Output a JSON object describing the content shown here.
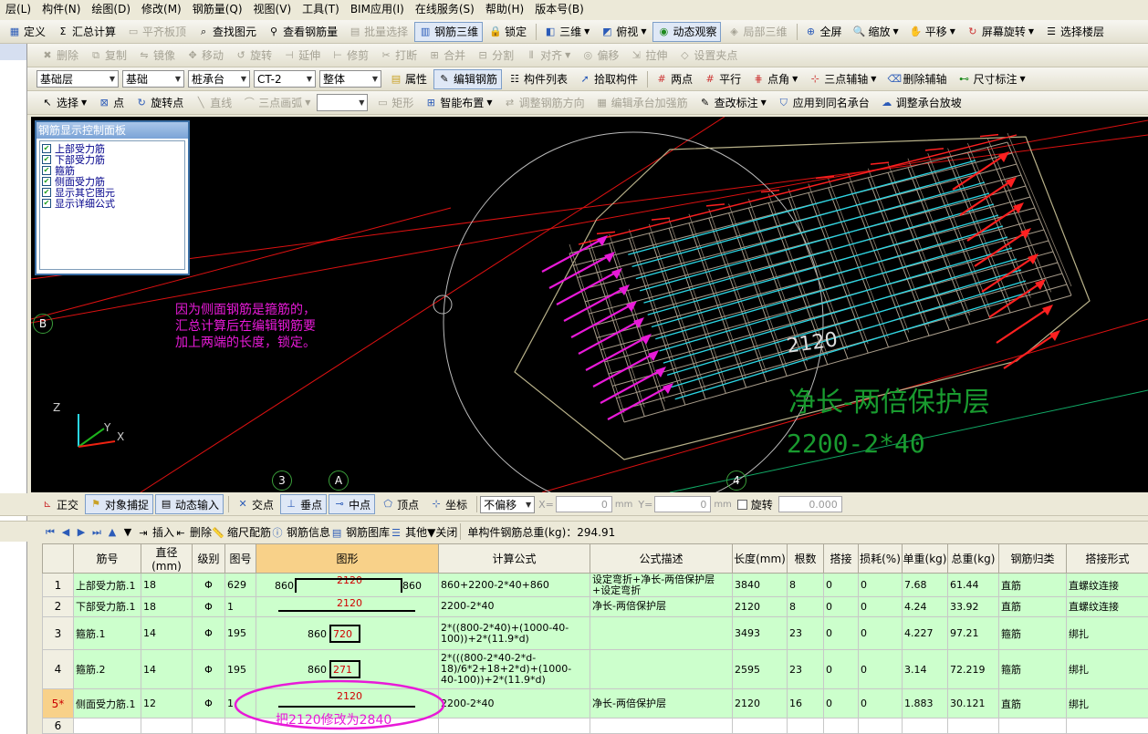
{
  "menu": [
    "层(L)",
    "构件(N)",
    "绘图(D)",
    "修改(M)",
    "钢筋量(Q)",
    "视图(V)",
    "工具(T)",
    "BIM应用(I)",
    "在线服务(S)",
    "帮助(H)",
    "版本号(B)"
  ],
  "toolbar1": {
    "define": "定义",
    "sum_calc": "汇总计算",
    "flush_board": "平齐板顶",
    "find_element": "查找图元",
    "view_rebar_qty": "查看钢筋量",
    "batch_select": "批量选择",
    "rebar_3d": "钢筋三维",
    "lock": "锁定",
    "view_3d": "三维",
    "top_view": "俯视",
    "dynamic_observe": "动态观察",
    "local_3d": "局部三维",
    "fullscreen": "全屏",
    "zoom": "缩放",
    "pan": "平移",
    "screen_rotate": "屏幕旋转",
    "select_floor": "选择楼层"
  },
  "toolbar2": {
    "delete": "删除",
    "copy": "复制",
    "mirror": "镜像",
    "move": "移动",
    "rotate": "旋转",
    "extend": "延伸",
    "trim": "修剪",
    "break": "打断",
    "merge": "合并",
    "split": "分割",
    "align": "对齐",
    "offset": "偏移",
    "stretch": "拉伸",
    "set_clamp": "设置夹点"
  },
  "toolbar3": {
    "layer": "基础层",
    "category": "基础",
    "element_type": "桩承台",
    "element_name": "CT-2",
    "scope": "整体",
    "properties": "属性",
    "edit_rebar": "编辑钢筋",
    "element_list": "构件列表",
    "pick_element": "拾取构件",
    "two_points": "两点",
    "parallel": "平行",
    "point_angle": "点角",
    "three_point_aux": "三点辅轴",
    "delete_aux": "删除辅轴",
    "dim_label": "尺寸标注"
  },
  "toolbar4": {
    "select": "选择",
    "point": "点",
    "rotate_point": "旋转点",
    "line": "直线",
    "three_point_arc": "三点画弧",
    "rect": "矩形",
    "smart_layout": "智能布置",
    "adjust_rebar_dir": "调整钢筋方向",
    "edit_cap_rebar": "编辑承台加强筋",
    "view_label": "查改标注",
    "apply_same_cap": "应用到同名承台",
    "adjust_cap_slope": "调整承台放坡"
  },
  "control_panel": {
    "title": "钢筋显示控制面板",
    "items": [
      "上部受力筋",
      "下部受力筋",
      "箍筋",
      "侧面受力筋",
      "显示其它图元",
      "显示详细公式"
    ]
  },
  "viewport": {
    "annotation": [
      "因为侧面钢筋是箍筋的，",
      "汇总计算后在编辑钢筋要",
      "加上两端的长度，锁定。"
    ],
    "dim_text": "2120",
    "green_note1": "净长-两倍保护层",
    "green_note2": "2200-2*40",
    "grid_labels": {
      "b": "B",
      "three": "3",
      "a": "A",
      "four": "4"
    },
    "axes": {
      "z": "Z",
      "y": "Y",
      "x": "X"
    }
  },
  "snapbar": {
    "ortho": "正交",
    "object_snap": "对象捕捉",
    "dynamic_input": "动态输入",
    "intersection": "交点",
    "perpendicular": "垂点",
    "midpoint": "中点",
    "vertex": "顶点",
    "coordinate": "坐标",
    "offset_mode": "不偏移",
    "x_label": "X=",
    "x_value": "0",
    "y_label": "Y=",
    "y_value": "0",
    "unit": "mm",
    "rotate": "旋转",
    "rotate_value": "0.000"
  },
  "tablebar": {
    "insert": "插入",
    "delete": "删除",
    "scale_rebar": "缩尺配筋",
    "rebar_info": "钢筋信息",
    "rebar_lib": "钢筋图库",
    "other": "其他",
    "close": "关闭",
    "total_weight": "单构件钢筋总重(kg)：294.91"
  },
  "table": {
    "headers": [
      "筋号",
      "直径(mm)",
      "级别",
      "图号",
      "图形",
      "计算公式",
      "公式描述",
      "长度(mm)",
      "根数",
      "搭接",
      "损耗(%)",
      "单重(kg)",
      "总重(kg)",
      "钢筋归类",
      "搭接形式"
    ],
    "rows": [
      {
        "n": "1",
        "name": "上部受力筋.1",
        "dia": "18",
        "grade": "Φ",
        "fig": "629",
        "s_left": "860",
        "s_mid": "2120",
        "s_right": "860",
        "formula": "860+2200-2*40+860",
        "desc": "设定弯折+净长-两倍保护层+设定弯折",
        "len": "3840",
        "qty": "8",
        "lap": "0",
        "loss": "0",
        "unit_w": "7.68",
        "total_w": "61.44",
        "cat": "直筋",
        "lap_type": "直螺纹连接"
      },
      {
        "n": "2",
        "name": "下部受力筋.1",
        "dia": "18",
        "grade": "Φ",
        "fig": "1",
        "s_mid": "2120",
        "formula": "2200-2*40",
        "desc": "净长-两倍保护层",
        "len": "2120",
        "qty": "8",
        "lap": "0",
        "loss": "0",
        "unit_w": "4.24",
        "total_w": "33.92",
        "cat": "直筋",
        "lap_type": "直螺纹连接"
      },
      {
        "n": "3",
        "name": "箍筋.1",
        "dia": "14",
        "grade": "Φ",
        "fig": "195",
        "s_left": "860",
        "s_mid": "720",
        "formula": "2*((800-2*40)+(1000-40-100))+2*(11.9*d)",
        "desc": "",
        "len": "3493",
        "qty": "23",
        "lap": "0",
        "loss": "0",
        "unit_w": "4.227",
        "total_w": "97.21",
        "cat": "箍筋",
        "lap_type": "绑扎"
      },
      {
        "n": "4",
        "name": "箍筋.2",
        "dia": "14",
        "grade": "Φ",
        "fig": "195",
        "s_left": "860",
        "s_mid": "271",
        "formula": "2*(((800-2*40-2*d-18)/6*2+18+2*d)+(1000-40-100))+2*(11.9*d)",
        "desc": "",
        "len": "2595",
        "qty": "23",
        "lap": "0",
        "loss": "0",
        "unit_w": "3.14",
        "total_w": "72.219",
        "cat": "箍筋",
        "lap_type": "绑扎"
      },
      {
        "n": "5*",
        "name": "侧面受力筋.1",
        "dia": "12",
        "grade": "Φ",
        "fig": "1",
        "s_mid": "2120",
        "formula": "2200-2*40",
        "desc": "净长-两倍保护层",
        "len": "2120",
        "qty": "16",
        "lap": "0",
        "loss": "0",
        "unit_w": "1.883",
        "total_w": "30.121",
        "cat": "直筋",
        "lap_type": "绑扎"
      },
      {
        "n": "6"
      }
    ],
    "circle_note": "把2120修改为2840"
  },
  "colors": {
    "pink": "#e81ad8",
    "green": "#199b2f",
    "cyan": "#2ad7e6",
    "red": "#ff2020",
    "row_bg": "#ccffcc"
  }
}
